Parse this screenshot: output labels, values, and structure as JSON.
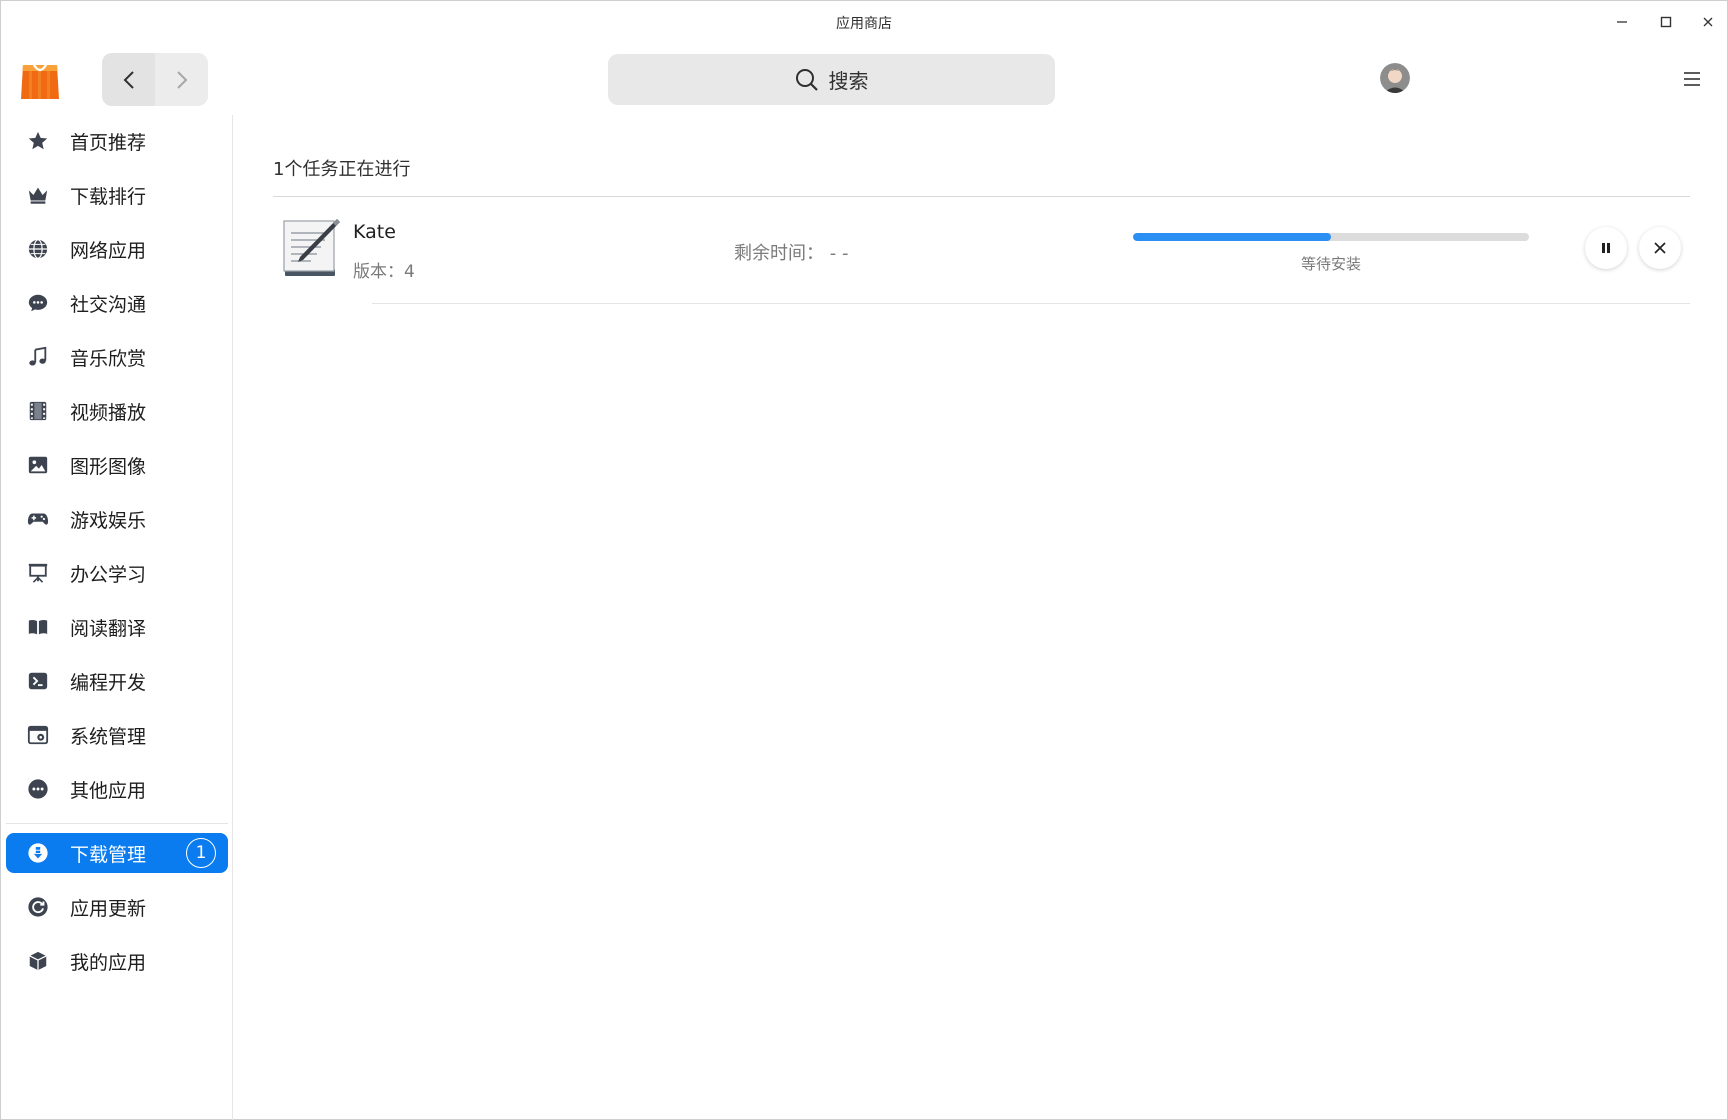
{
  "window": {
    "title": "应用商店",
    "controls": {
      "minimize": "minimize-icon",
      "maximize": "maximize-icon",
      "close": "close-icon"
    }
  },
  "toolbar": {
    "logo": "app-store-logo",
    "search_label": "搜索",
    "icons": {
      "back": "chevron-left-icon",
      "forward": "chevron-right-icon",
      "search": "search-icon",
      "menu": "menu-icon"
    }
  },
  "sidebar": {
    "items": [
      {
        "label": "首页推荐",
        "icon": "star-icon"
      },
      {
        "label": "下载排行",
        "icon": "crown-icon"
      },
      {
        "label": "网络应用",
        "icon": "globe-icon"
      },
      {
        "label": "社交沟通",
        "icon": "chat-icon"
      },
      {
        "label": "音乐欣赏",
        "icon": "music-icon"
      },
      {
        "label": "视频播放",
        "icon": "film-icon"
      },
      {
        "label": "图形图像",
        "icon": "image-icon"
      },
      {
        "label": "游戏娱乐",
        "icon": "gamepad-icon"
      },
      {
        "label": "办公学习",
        "icon": "presentation-icon"
      },
      {
        "label": "阅读翻译",
        "icon": "book-icon"
      },
      {
        "label": "编程开发",
        "icon": "terminal-icon"
      },
      {
        "label": "系统管理",
        "icon": "system-icon"
      },
      {
        "label": "其他应用",
        "icon": "more-icon"
      }
    ],
    "bottom_items": [
      {
        "label": "下载管理",
        "icon": "download-icon",
        "badge": "1",
        "active": true
      },
      {
        "label": "应用更新",
        "icon": "refresh-icon"
      },
      {
        "label": "我的应用",
        "icon": "package-icon"
      }
    ]
  },
  "main": {
    "tasks_title": "1个任务正在进行",
    "task": {
      "name": "Kate",
      "version": "版本：4",
      "remaining": "剩余时间：  - -",
      "progress_percent": 50,
      "status": "等待安装",
      "icon": "kate-app-icon",
      "actions": {
        "pause": "pause-icon",
        "cancel": "close-icon"
      }
    }
  },
  "colors": {
    "accent": "#0a7cf0",
    "progress": "#2b8ef3",
    "icon_gray": "#3d4450"
  }
}
